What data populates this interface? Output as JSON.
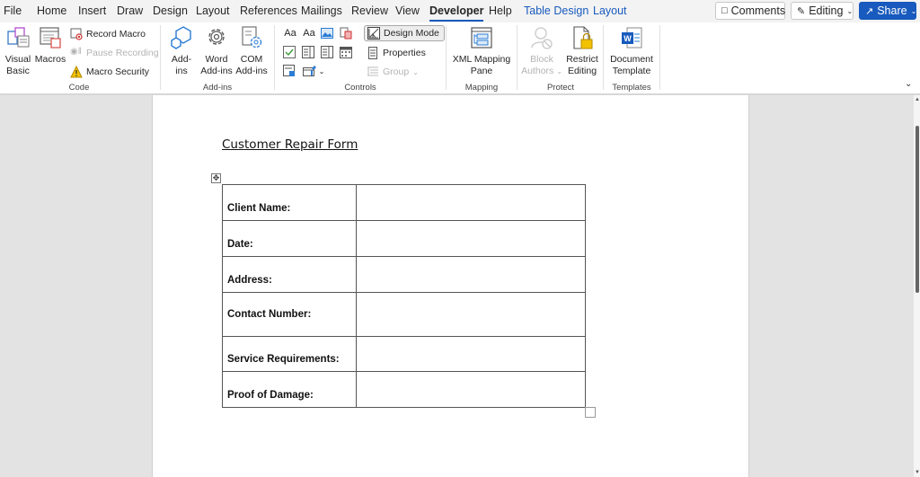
{
  "menu": {
    "tabs": [
      {
        "label": "File"
      },
      {
        "label": "Home"
      },
      {
        "label": "Insert"
      },
      {
        "label": "Draw"
      },
      {
        "label": "Design"
      },
      {
        "label": "Layout"
      },
      {
        "label": "References"
      },
      {
        "label": "Mailings"
      },
      {
        "label": "Review"
      },
      {
        "label": "View"
      },
      {
        "label": "Developer",
        "active": true
      },
      {
        "label": "Help"
      },
      {
        "label": "Table Design",
        "contextual": true
      },
      {
        "label": "Layout",
        "contextual": true
      }
    ],
    "comments_label": "Comments",
    "editing_label": "Editing",
    "share_label": "Share",
    "accent_color": "#185abd"
  },
  "ribbon": {
    "code": {
      "label": "Code",
      "visual_basic": "Visual Basic",
      "visual_basic_l1": "Visual",
      "visual_basic_l2": "Basic",
      "macros": "Macros",
      "record_macro": "Record Macro",
      "pause_recording": "Pause Recording",
      "macro_security": "Macro Security"
    },
    "addins": {
      "label": "Add-ins",
      "addins_l1": "Add-",
      "addins_l2": "ins",
      "word_l1": "Word",
      "word_l2": "Add-ins",
      "com_l1": "COM",
      "com_l2": "Add-ins"
    },
    "controls": {
      "label": "Controls",
      "rich_text": "Aa",
      "plain_text": "Aa",
      "design_mode": "Design Mode",
      "properties": "Properties",
      "group": "Group"
    },
    "mapping": {
      "label": "Mapping",
      "xml_l1": "XML Mapping",
      "xml_l2": "Pane"
    },
    "protect": {
      "label": "Protect",
      "block_l1": "Block",
      "block_l2": "Authors",
      "restrict_l1": "Restrict",
      "restrict_l2": "Editing"
    },
    "templates": {
      "label": "Templates",
      "doc_l1": "Document",
      "doc_l2": "Template"
    }
  },
  "document": {
    "title": "Customer Repair Form",
    "rows": [
      {
        "label": "Client Name:",
        "value": ""
      },
      {
        "label": "Date:",
        "value": ""
      },
      {
        "label": "Address:",
        "value": ""
      },
      {
        "label": "Contact Number:",
        "value": ""
      },
      {
        "label": "Service Requirements:",
        "value": ""
      },
      {
        "label": "Proof of Damage:",
        "value": ""
      }
    ]
  }
}
